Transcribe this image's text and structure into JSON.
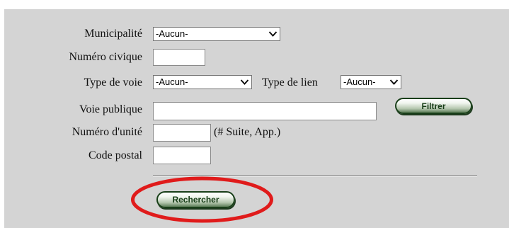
{
  "form": {
    "municipalite": {
      "label": "Municipalité",
      "value": "-Aucun-"
    },
    "numero_civique": {
      "label": "Numéro civique",
      "value": ""
    },
    "type_de_voie": {
      "label": "Type de voie",
      "value": "-Aucun-"
    },
    "type_de_lien": {
      "label": "Type de lien",
      "value": "-Aucun-"
    },
    "voie_publique": {
      "label": "Voie publique",
      "value": ""
    },
    "filtrer_button": "Filtrer",
    "numero_unite": {
      "label": "Numéro d'unité",
      "value": "",
      "hint": "(# Suite, App.)"
    },
    "code_postal": {
      "label": "Code postal",
      "value": ""
    },
    "rechercher_button": "Rechercher"
  },
  "colors": {
    "panel_bg": "#d4d4d4",
    "button_border": "#193f19",
    "highlight": "#e01b1b"
  },
  "icons": {
    "dropdown": "chevron-down-icon"
  }
}
